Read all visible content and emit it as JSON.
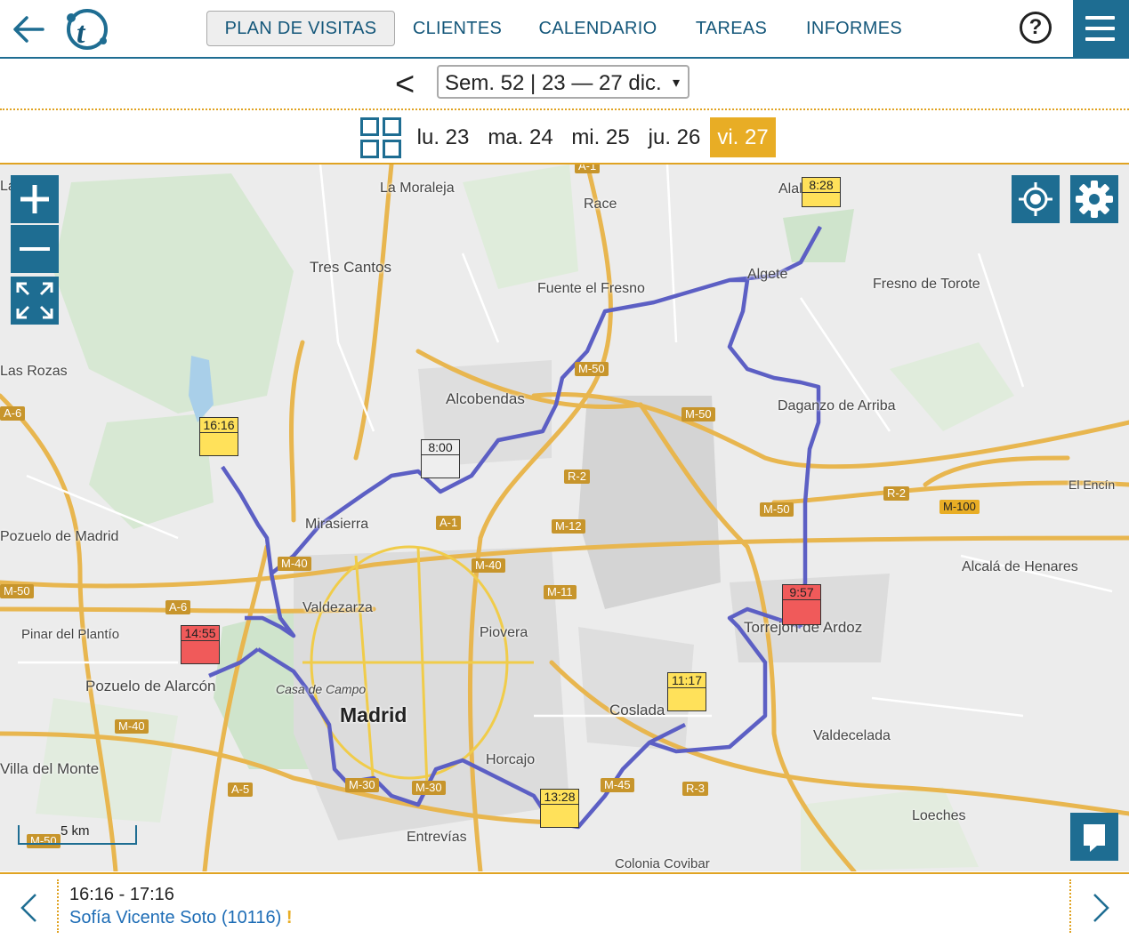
{
  "nav": {
    "tabs": [
      "PLAN DE VISITAS",
      "CLIENTES",
      "CALENDARIO",
      "TAREAS",
      "INFORMES"
    ],
    "active_tab": "PLAN DE VISITAS",
    "help_label": "?"
  },
  "week": {
    "prev_label": "<",
    "selected": "Sem. 52 | 23 — 27 dic.",
    "arrow": "▾"
  },
  "days": [
    "lu. 23",
    "ma. 24",
    "mi. 25",
    "ju. 26",
    "vi. 27"
  ],
  "active_day": "vi. 27",
  "map": {
    "places": [
      "La Moraleja",
      "Race",
      "Tres Cantos",
      "Fuente el Fresno",
      "Algete",
      "Fresno de Torote",
      "Las Rozas",
      "Alcobendas",
      "Daganzo de Arriba",
      "Mirasierra",
      "El Encín",
      "Pozuelo de Madrid",
      "Alcalá de Henares",
      "Valdezarza",
      "Piovera",
      "Torrejón de Ardoz",
      "Pinar del Plantío",
      "Pozuelo de Alarcón",
      "Casa de Campo",
      "Madrid",
      "Coslada",
      "Valdecelada",
      "Horcajo",
      "Villa del Monte",
      "Loeches",
      "Entrevías",
      "Colonia Covibar",
      "La Nava",
      "Alalpardo"
    ],
    "roads": [
      "A-1",
      "M-50",
      "M-50",
      "R-2",
      "M-12",
      "A-1",
      "M-40",
      "M-40",
      "M-11",
      "M-50",
      "R-2",
      "M-100",
      "A-6",
      "A-6",
      "M-50",
      "M-40",
      "A-5",
      "M-30",
      "M-30",
      "M-45",
      "R-3",
      "M-50",
      "M-40"
    ],
    "scale_label": "5 km",
    "pins": [
      {
        "time": "8:28",
        "status": "yellow"
      },
      {
        "time": "16:16",
        "status": "yellow"
      },
      {
        "time": "8:00",
        "status": "grey"
      },
      {
        "time": "9:57",
        "status": "red"
      },
      {
        "time": "14:55",
        "status": "red"
      },
      {
        "time": "11:17",
        "status": "yellow"
      },
      {
        "time": "13:28",
        "status": "yellow"
      }
    ],
    "colors": {
      "route": "#5c5fc4",
      "yellow_pin": "#ffe15a",
      "red_pin": "#f05a5a",
      "grey_pin": "#eeeeee",
      "accent": "#1e6d92",
      "highlight": "#e8ad25"
    }
  },
  "visit": {
    "time_range": "16:16 - 17:16",
    "client": "Sofía Vicente Soto (10116)",
    "alert": "!"
  }
}
